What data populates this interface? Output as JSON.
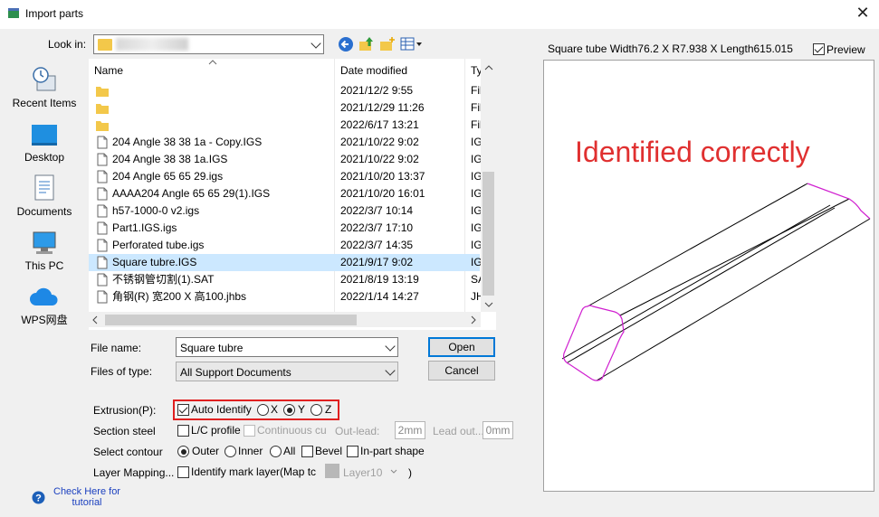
{
  "window": {
    "title": "Import parts",
    "close": "✕"
  },
  "lookin": {
    "label": "Look in:"
  },
  "places": [
    {
      "label": "Recent Items"
    },
    {
      "label": "Desktop"
    },
    {
      "label": "Documents"
    },
    {
      "label": "This PC"
    },
    {
      "label": "WPS网盘"
    }
  ],
  "filelist": {
    "headers": {
      "name": "Name",
      "date": "Date modified",
      "type": "Ty"
    },
    "rows": [
      {
        "name": "",
        "date": "2021/12/2 9:55",
        "type": "Fil",
        "kind": "folder"
      },
      {
        "name": "",
        "date": "2021/12/29 11:26",
        "type": "Fil",
        "kind": "folder"
      },
      {
        "name": "",
        "date": "2022/6/17 13:21",
        "type": "Fil",
        "kind": "folder"
      },
      {
        "name": "204 Angle 38 38 1a - Copy.IGS",
        "date": "2021/10/22 9:02",
        "type": "IG",
        "kind": "file"
      },
      {
        "name": "204 Angle 38 38 1a.IGS",
        "date": "2021/10/22 9:02",
        "type": "IG",
        "kind": "file"
      },
      {
        "name": "204 Angle 65 65 29.igs",
        "date": "2021/10/20 13:37",
        "type": "IG",
        "kind": "file"
      },
      {
        "name": "AAAA204 Angle 65 65 29(1).IGS",
        "date": "2021/10/20 16:01",
        "type": "IG",
        "kind": "file"
      },
      {
        "name": "h57-1000-0 v2.igs",
        "date": "2022/3/7 10:14",
        "type": "IG",
        "kind": "file"
      },
      {
        "name": "Part1.IGS.igs",
        "date": "2022/3/7 17:10",
        "type": "IG",
        "kind": "file"
      },
      {
        "name": "Perforated tube.igs",
        "date": "2022/3/7 14:35",
        "type": "IG",
        "kind": "file"
      },
      {
        "name": "Square tubre.IGS",
        "date": "2021/9/17 9:02",
        "type": "IG",
        "kind": "file",
        "selected": true
      },
      {
        "name": "不锈钢管切割(1).SAT",
        "date": "2021/8/19 13:19",
        "type": "SA",
        "kind": "file"
      },
      {
        "name": "角钢(R) 宽200 X 高100.jhbs",
        "date": "2022/1/14 14:27",
        "type": "JH",
        "kind": "file"
      }
    ]
  },
  "filename": {
    "label": "File name:",
    "value": "Square tubre"
  },
  "filetype": {
    "label": "Files of type:",
    "value": "All Support Documents"
  },
  "buttons": {
    "open": "Open",
    "cancel": "Cancel"
  },
  "extrusion": {
    "label": "Extrusion(P):",
    "auto": "Auto Identify",
    "x": "X",
    "y": "Y",
    "z": "Z"
  },
  "section": {
    "label": "Section steel",
    "lc": "L/C profile",
    "continuous": "Continuous cu",
    "outlead": "Out-lead:",
    "outlead_val": "2mm",
    "leadout": "Lead out...",
    "leadout_val": "0mm"
  },
  "contour": {
    "label": "Select contour",
    "outer": "Outer",
    "inner": "Inner",
    "all": "All",
    "bevel": "Bevel",
    "inpart": "In-part shape"
  },
  "layer": {
    "label": "Layer Mapping...",
    "identify": "Identify mark layer(Map tc",
    "layer": "Layer10",
    "paren": ")"
  },
  "help": {
    "text": "Check Here for tutorial"
  },
  "preview": {
    "title": "Square tube Width76.2 X R7.938 X Length615.015",
    "checkbox": "Preview",
    "annotation": "Identified correctly"
  },
  "colors": {
    "accent": "#0078d7",
    "annotation": "#e03030",
    "outline": "#d020d0",
    "selected_row": "#cce8ff"
  }
}
